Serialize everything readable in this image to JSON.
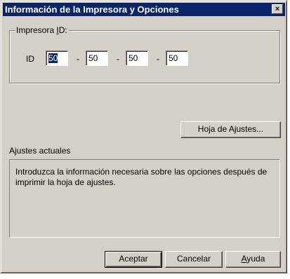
{
  "window": {
    "title": "Información de la Impresora y Opciones",
    "close_glyph": "×"
  },
  "printer_group": {
    "legend_prefix": "Impresora ",
    "legend_accel": "I",
    "legend_suffix": "D:",
    "id_label": "ID",
    "id_values": [
      "50",
      "50",
      "50",
      "50"
    ],
    "separator": "-"
  },
  "buttons": {
    "settings_sheet": "Hoja de Ajustes...",
    "accept": "Aceptar",
    "cancel": "Cancelar",
    "help_accel": "A",
    "help_rest": "yuda"
  },
  "current_settings": {
    "label": "Ajustes actuales",
    "message": "Introduzca la información necesaria sobre las opciones después de imprimir la hoja de ajustes."
  },
  "colors": {
    "titlebar": "#0a246a",
    "face": "#d4d0c8",
    "selection": "#0a246a"
  }
}
